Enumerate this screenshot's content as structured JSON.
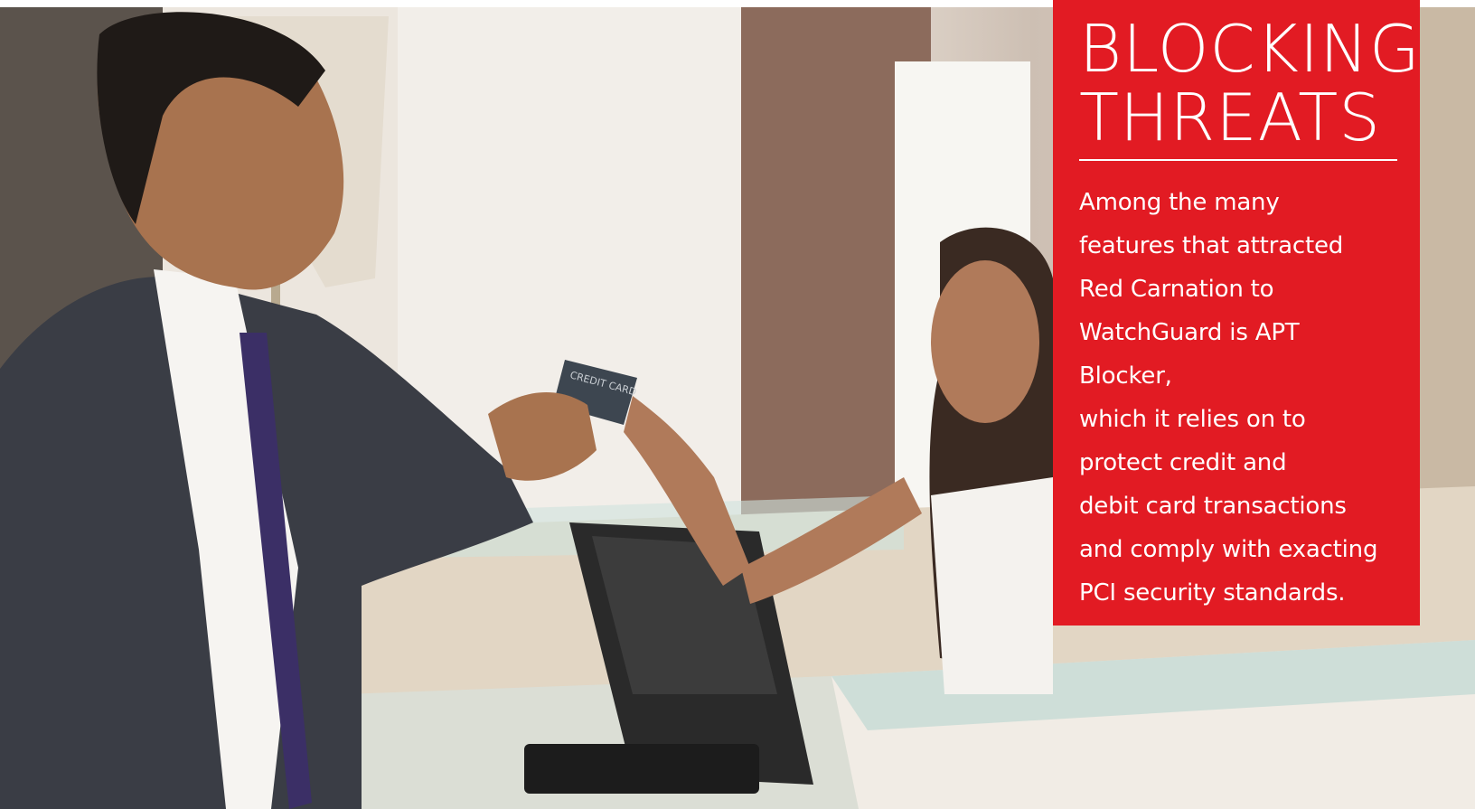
{
  "photo": {
    "subject": "hotel-front-desk-payment",
    "card_text": "CREDIT CARD"
  },
  "callout": {
    "headline_line1": "BLOCKING",
    "headline_line2": "THREATS",
    "body": "Among the many\nfeatures that attracted\nRed Carnation to\nWatchGuard is APT Blocker,\nwhich it relies on to\nprotect credit and\ndebit card transactions\nand comply with exacting\nPCI security standards.",
    "panel_color": "#e21b23"
  }
}
